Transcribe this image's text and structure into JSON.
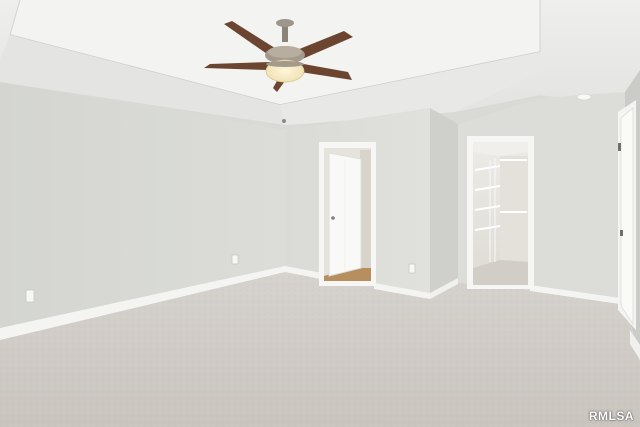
{
  "photo": {
    "subject": "empty-bedroom-interior",
    "watermark": "RMLSA",
    "colors": {
      "wall": "#d7d8d4",
      "ceiling": "#eeeeec",
      "carpet": "#cfcac4",
      "trim": "#f4f4f2",
      "fan_blade": "#6b4530",
      "floor_wood": "#b78f5e"
    }
  }
}
